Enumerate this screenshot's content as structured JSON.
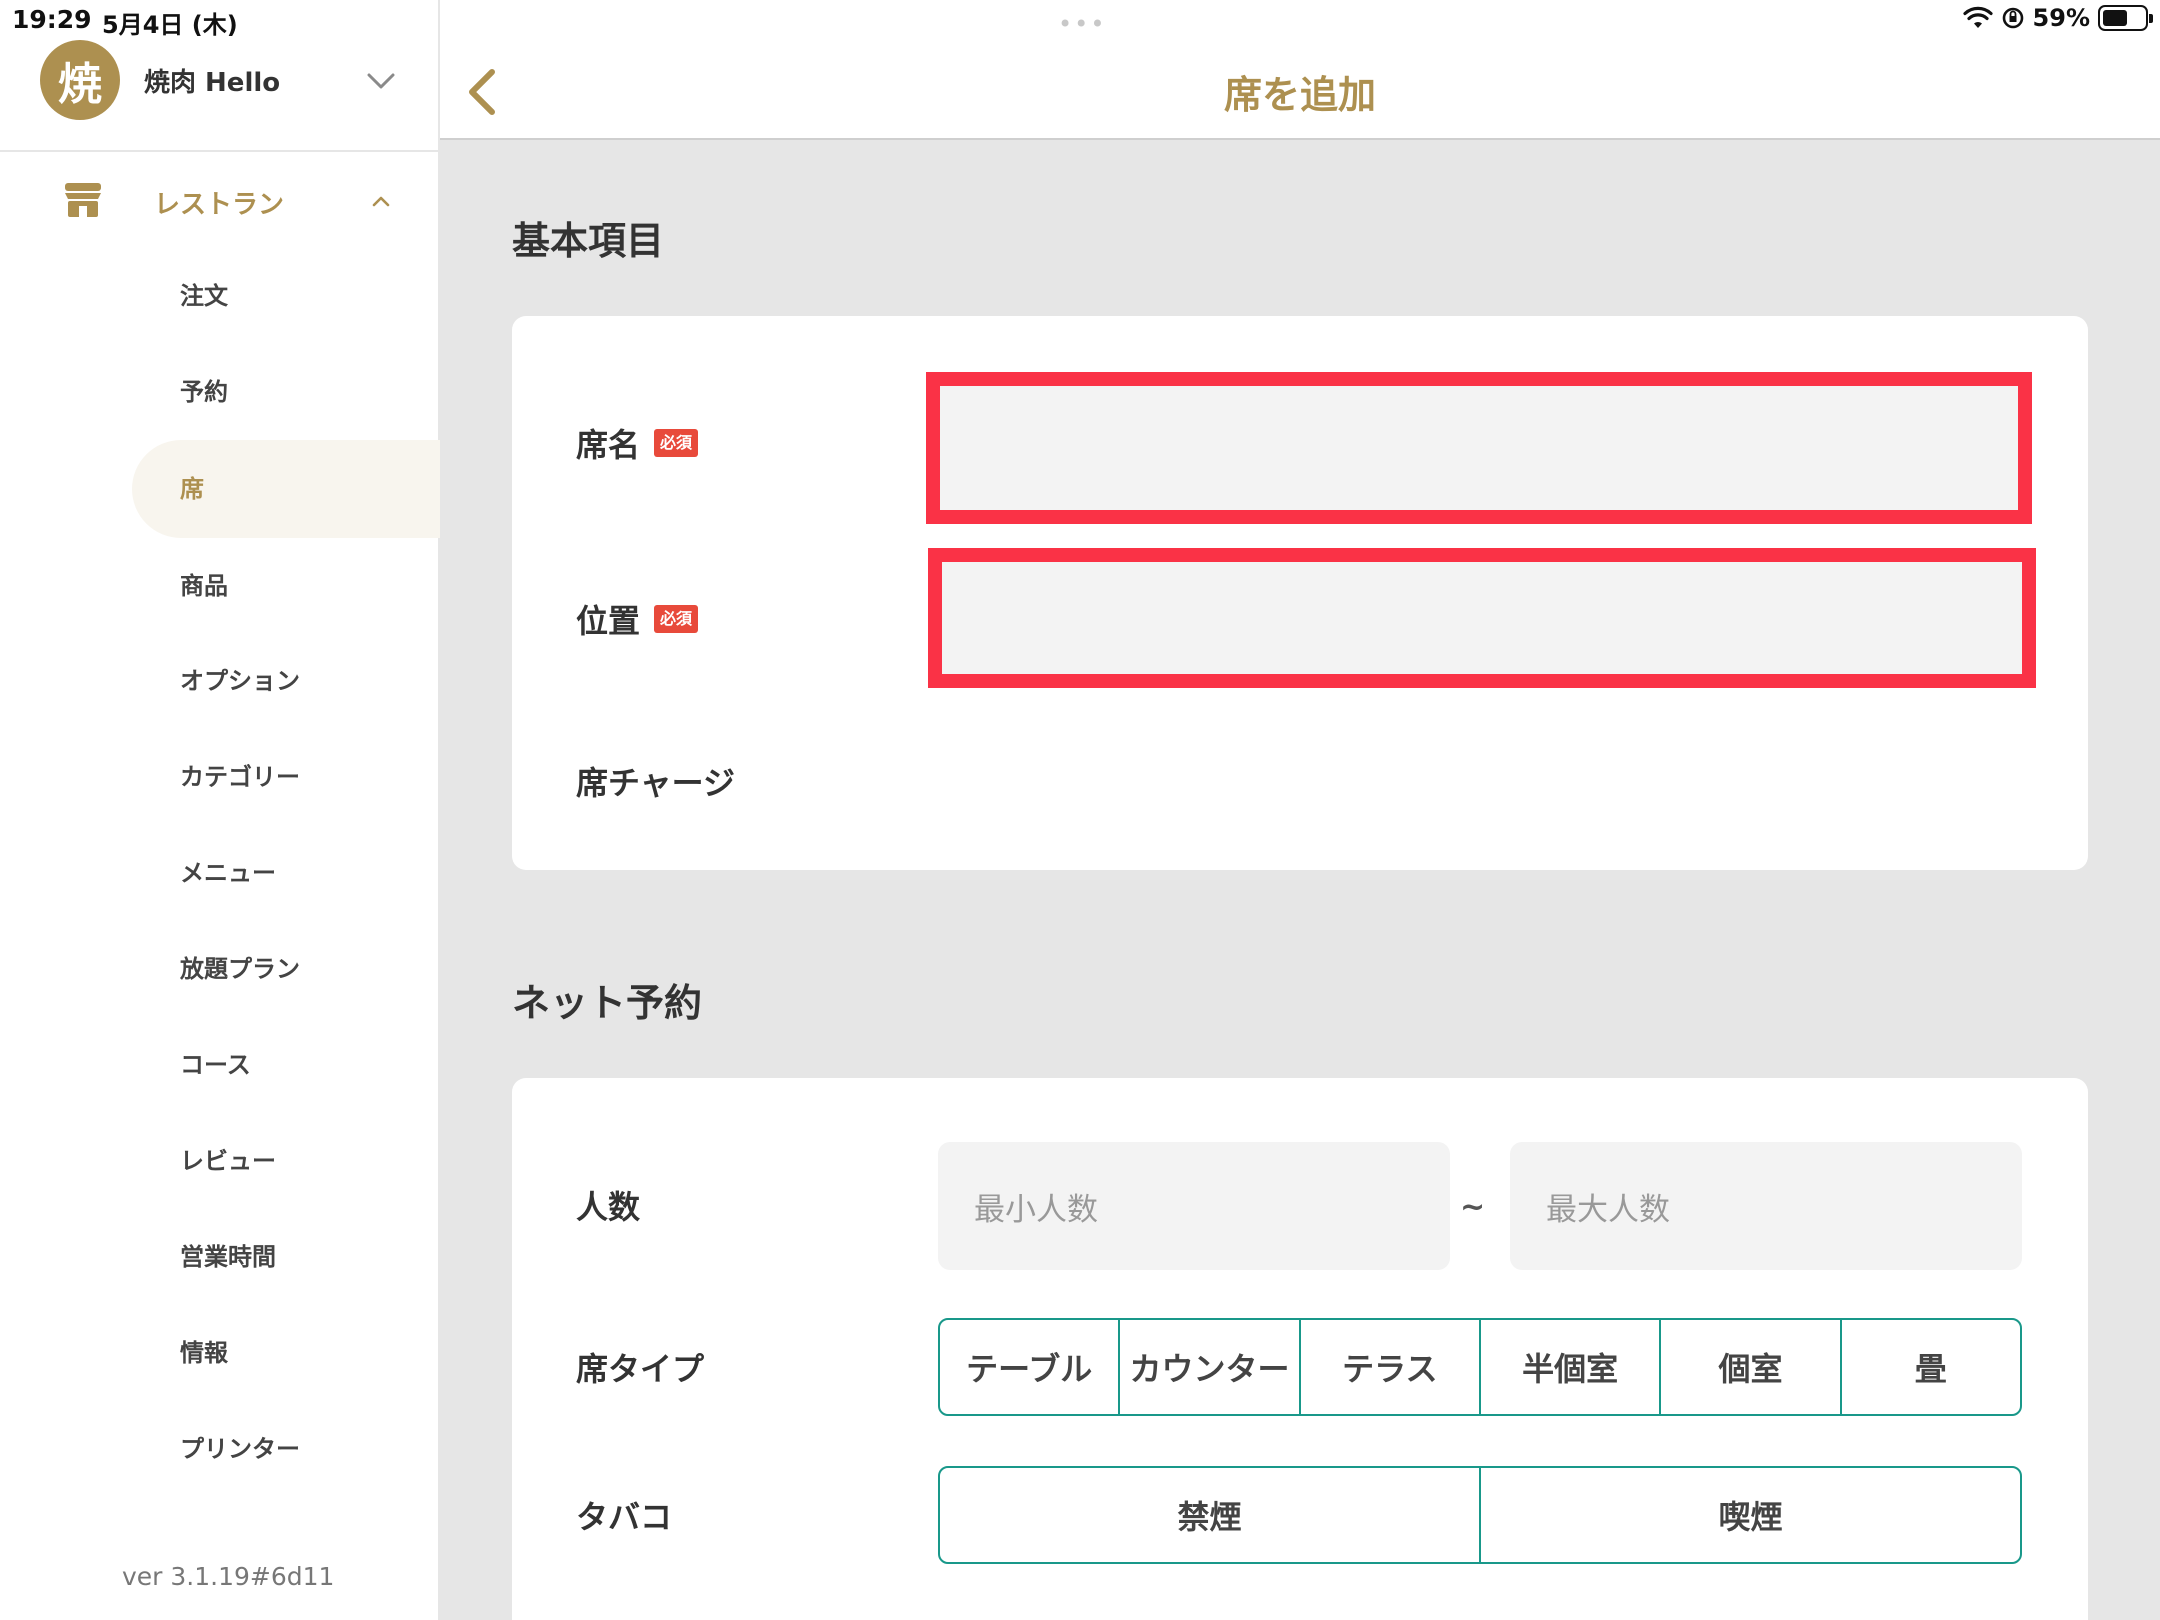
{
  "status_bar": {
    "time": "19:29",
    "date": "5月4日 (木)",
    "battery": "59%",
    "battery_level": 0.59
  },
  "store": {
    "avatar_char": "焼",
    "name": "焼肉 Hello"
  },
  "sidebar": {
    "section_label": "レストラン",
    "items": [
      {
        "label": "注文"
      },
      {
        "label": "予約"
      },
      {
        "label": "席",
        "active": true
      },
      {
        "label": "商品"
      },
      {
        "label": "オプション"
      },
      {
        "label": "カテゴリー"
      },
      {
        "label": "メニュー"
      },
      {
        "label": "放題プラン"
      },
      {
        "label": "コース"
      },
      {
        "label": "レビュー"
      },
      {
        "label": "営業時間"
      },
      {
        "label": "情報"
      },
      {
        "label": "プリンター"
      }
    ],
    "version": "ver 3.1.19#6d11"
  },
  "header": {
    "title": "席を追加"
  },
  "basic": {
    "section_title": "基本項目",
    "seat_name_label": "席名",
    "position_label": "位置",
    "required_badge": "必須",
    "seat_charge_label": "席チャージ",
    "seat_name_value": "",
    "position_value": ""
  },
  "net_reservation": {
    "section_title": "ネット予約",
    "people_label": "人数",
    "min_placeholder": "最小人数",
    "tilde": "~",
    "max_placeholder": "最大人数",
    "seat_type_label": "席タイプ",
    "seat_types": [
      "テーブル",
      "カウンター",
      "テラス",
      "半個室",
      "個室",
      "畳"
    ],
    "tobacco_label": "タバコ",
    "tobacco_options": [
      "禁煙",
      "喫煙"
    ]
  },
  "colors": {
    "accent_gold": "#ad9050",
    "teal": "#19988a",
    "highlight_red": "#fa3246",
    "badge_red": "#e84a3b"
  }
}
